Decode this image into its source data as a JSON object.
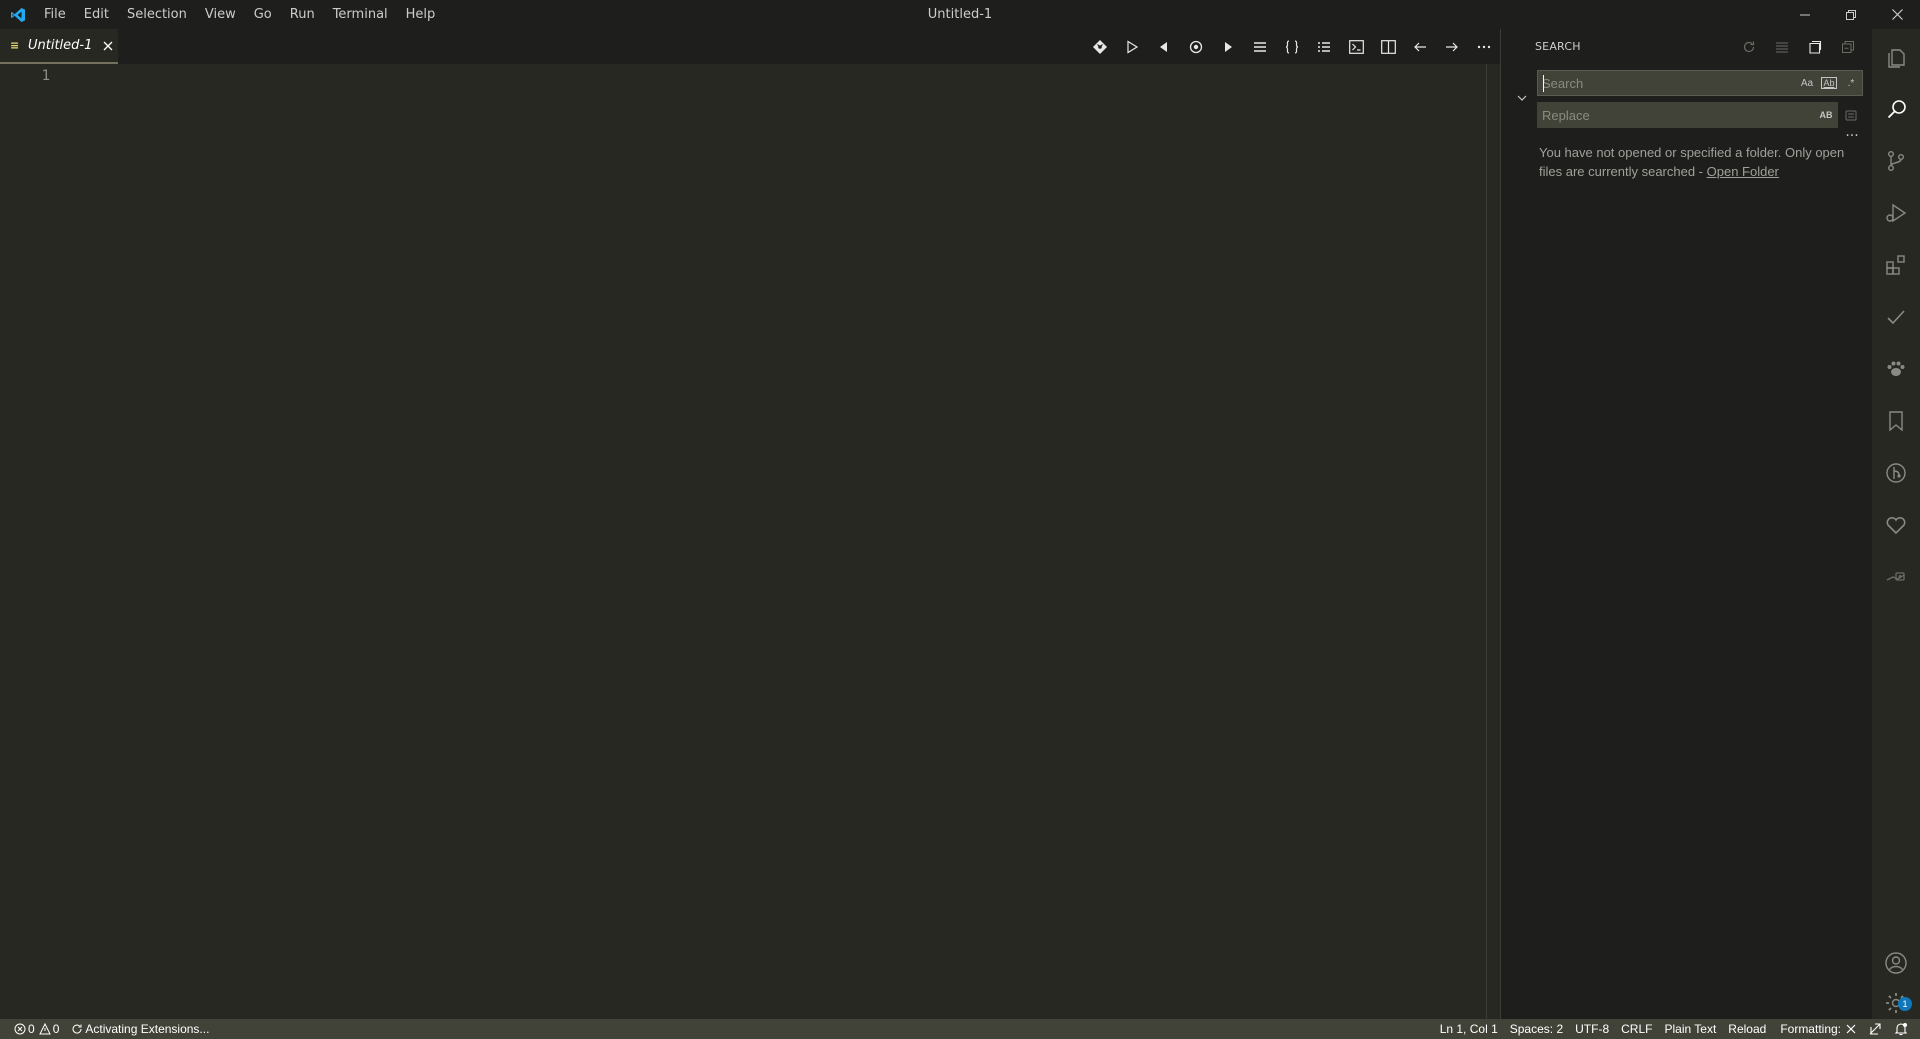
{
  "window": {
    "title": "Untitled-1",
    "menu": [
      "File",
      "Edit",
      "Selection",
      "View",
      "Go",
      "Run",
      "Terminal",
      "Help"
    ]
  },
  "tabs": [
    {
      "label": "Untitled-1",
      "lang_glyph": "≡",
      "dirty": false
    }
  ],
  "editor": {
    "line_numbers": [
      "1"
    ]
  },
  "sidebar": {
    "title": "SEARCH",
    "search_placeholder": "Search",
    "replace_placeholder": "Replace",
    "match_case_label": "Aa",
    "whole_word_label": "Ab",
    "regex_label": ".*",
    "preserve_case_label": "AB",
    "more_label": "···",
    "message": "You have not opened or specified a folder. Only open files are currently searched - ",
    "open_folder_link": "Open Folder"
  },
  "activitybar": {
    "items": [
      "explorer-icon",
      "search-icon",
      "source-control-icon",
      "run-debug-icon",
      "extensions-icon",
      "checkmark-icon",
      "paw-icon",
      "bookmark-icon",
      "git-graph-icon",
      "heart-icon",
      "remote-icon"
    ],
    "bottom": [
      "account-icon",
      "settings-gear-icon"
    ],
    "settings_badge": "1"
  },
  "statusbar": {
    "errors": "0",
    "warnings": "0",
    "activity": "Activating Extensions...",
    "position": "Ln 1, Col 1",
    "indent": "Spaces: 2",
    "encoding": "UTF-8",
    "eol": "CRLF",
    "language": "Plain Text",
    "reload": "Reload",
    "formatting": "Formatting:"
  },
  "colors": {
    "editor_bg": "#272822",
    "chrome_bg": "#1e1f1c",
    "statusbar_bg": "#414339",
    "accent_yellow": "#e6db74"
  }
}
